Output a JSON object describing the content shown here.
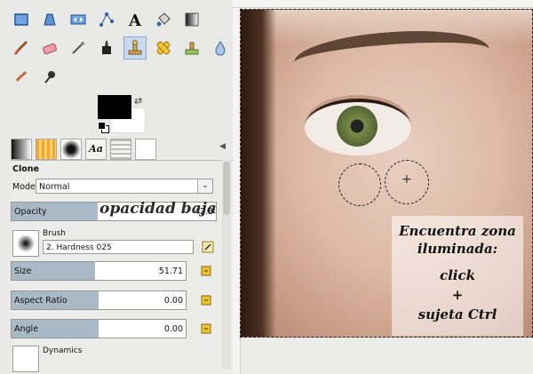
{
  "toolbox": {
    "tools_row1": [
      "select-rect",
      "move",
      "transform",
      "path",
      "text",
      "fill",
      "blend"
    ],
    "tools_row2": [
      "paintbrush",
      "eraser",
      "airbrush",
      "ink",
      "clone",
      "heal",
      "dodge",
      "smudge"
    ],
    "tools_row3": [
      "smudge-alt",
      "burn"
    ]
  },
  "colors": {
    "fg": "#000000",
    "bg": "#ffffff"
  },
  "panel": {
    "title": "Clone",
    "mode_label": "Mode:",
    "mode_value": "Normal",
    "opacity_label": "Opacity",
    "opacity_value": "42.3",
    "opacity_fill_percent": 42.3,
    "overlay_text": "opacidad baja",
    "brush_label": "Brush",
    "brush_value": "2. Hardness 025",
    "size_label": "Size",
    "size_value": "51.71",
    "size_fill_percent": 48,
    "aspect_label": "Aspect Ratio",
    "aspect_value": "0.00",
    "aspect_fill_percent": 50,
    "angle_label": "Angle",
    "angle_value": "0.00",
    "angle_fill_percent": 50,
    "dynamics_label": "Dynamics"
  },
  "canvas_note": {
    "line1": "Encuentra zona",
    "line2": "iluminada:",
    "line3": "click",
    "line4": "+",
    "line5": "sujeta Ctrl"
  }
}
